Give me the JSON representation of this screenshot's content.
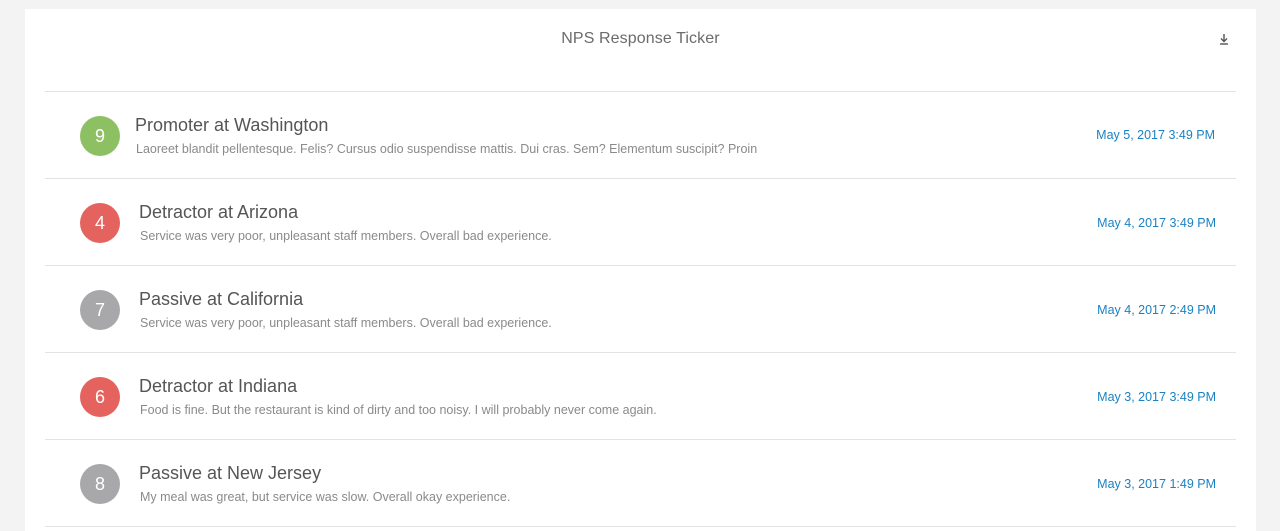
{
  "widget": {
    "title": "NPS Response Ticker",
    "download_icon": "download-icon"
  },
  "colors": {
    "promoter": "#8dc063",
    "detractor": "#e5635e",
    "passive": "#a8a8aa",
    "timestamp": "#1b82c2"
  },
  "responses": [
    {
      "score": "9",
      "category": "promoter",
      "heading": "Promoter at Washington",
      "comment": "Laoreet blandit pellentesque. Felis? Cursus odio suspendisse mattis. Dui cras. Sem? Elementum suscipit? Proin",
      "timestamp": "May 5, 2017 3:49 PM"
    },
    {
      "score": "4",
      "category": "detractor",
      "heading": "Detractor at Arizona",
      "comment": "Service was very poor, unpleasant staff members. Overall bad experience.",
      "timestamp": "May 4, 2017 3:49 PM"
    },
    {
      "score": "7",
      "category": "passive",
      "heading": "Passive at California",
      "comment": "Service was very poor, unpleasant staff members. Overall bad experience.",
      "timestamp": "May 4, 2017 2:49 PM"
    },
    {
      "score": "6",
      "category": "detractor",
      "heading": "Detractor at Indiana",
      "comment": "Food is fine. But the restaurant is kind of dirty and too noisy. I will probably never come again.",
      "timestamp": "May 3, 2017 3:49 PM"
    },
    {
      "score": "8",
      "category": "passive",
      "heading": "Passive at New Jersey",
      "comment": "My meal was great, but service was slow. Overall okay experience.",
      "timestamp": "May 3, 2017 1:49 PM"
    }
  ]
}
